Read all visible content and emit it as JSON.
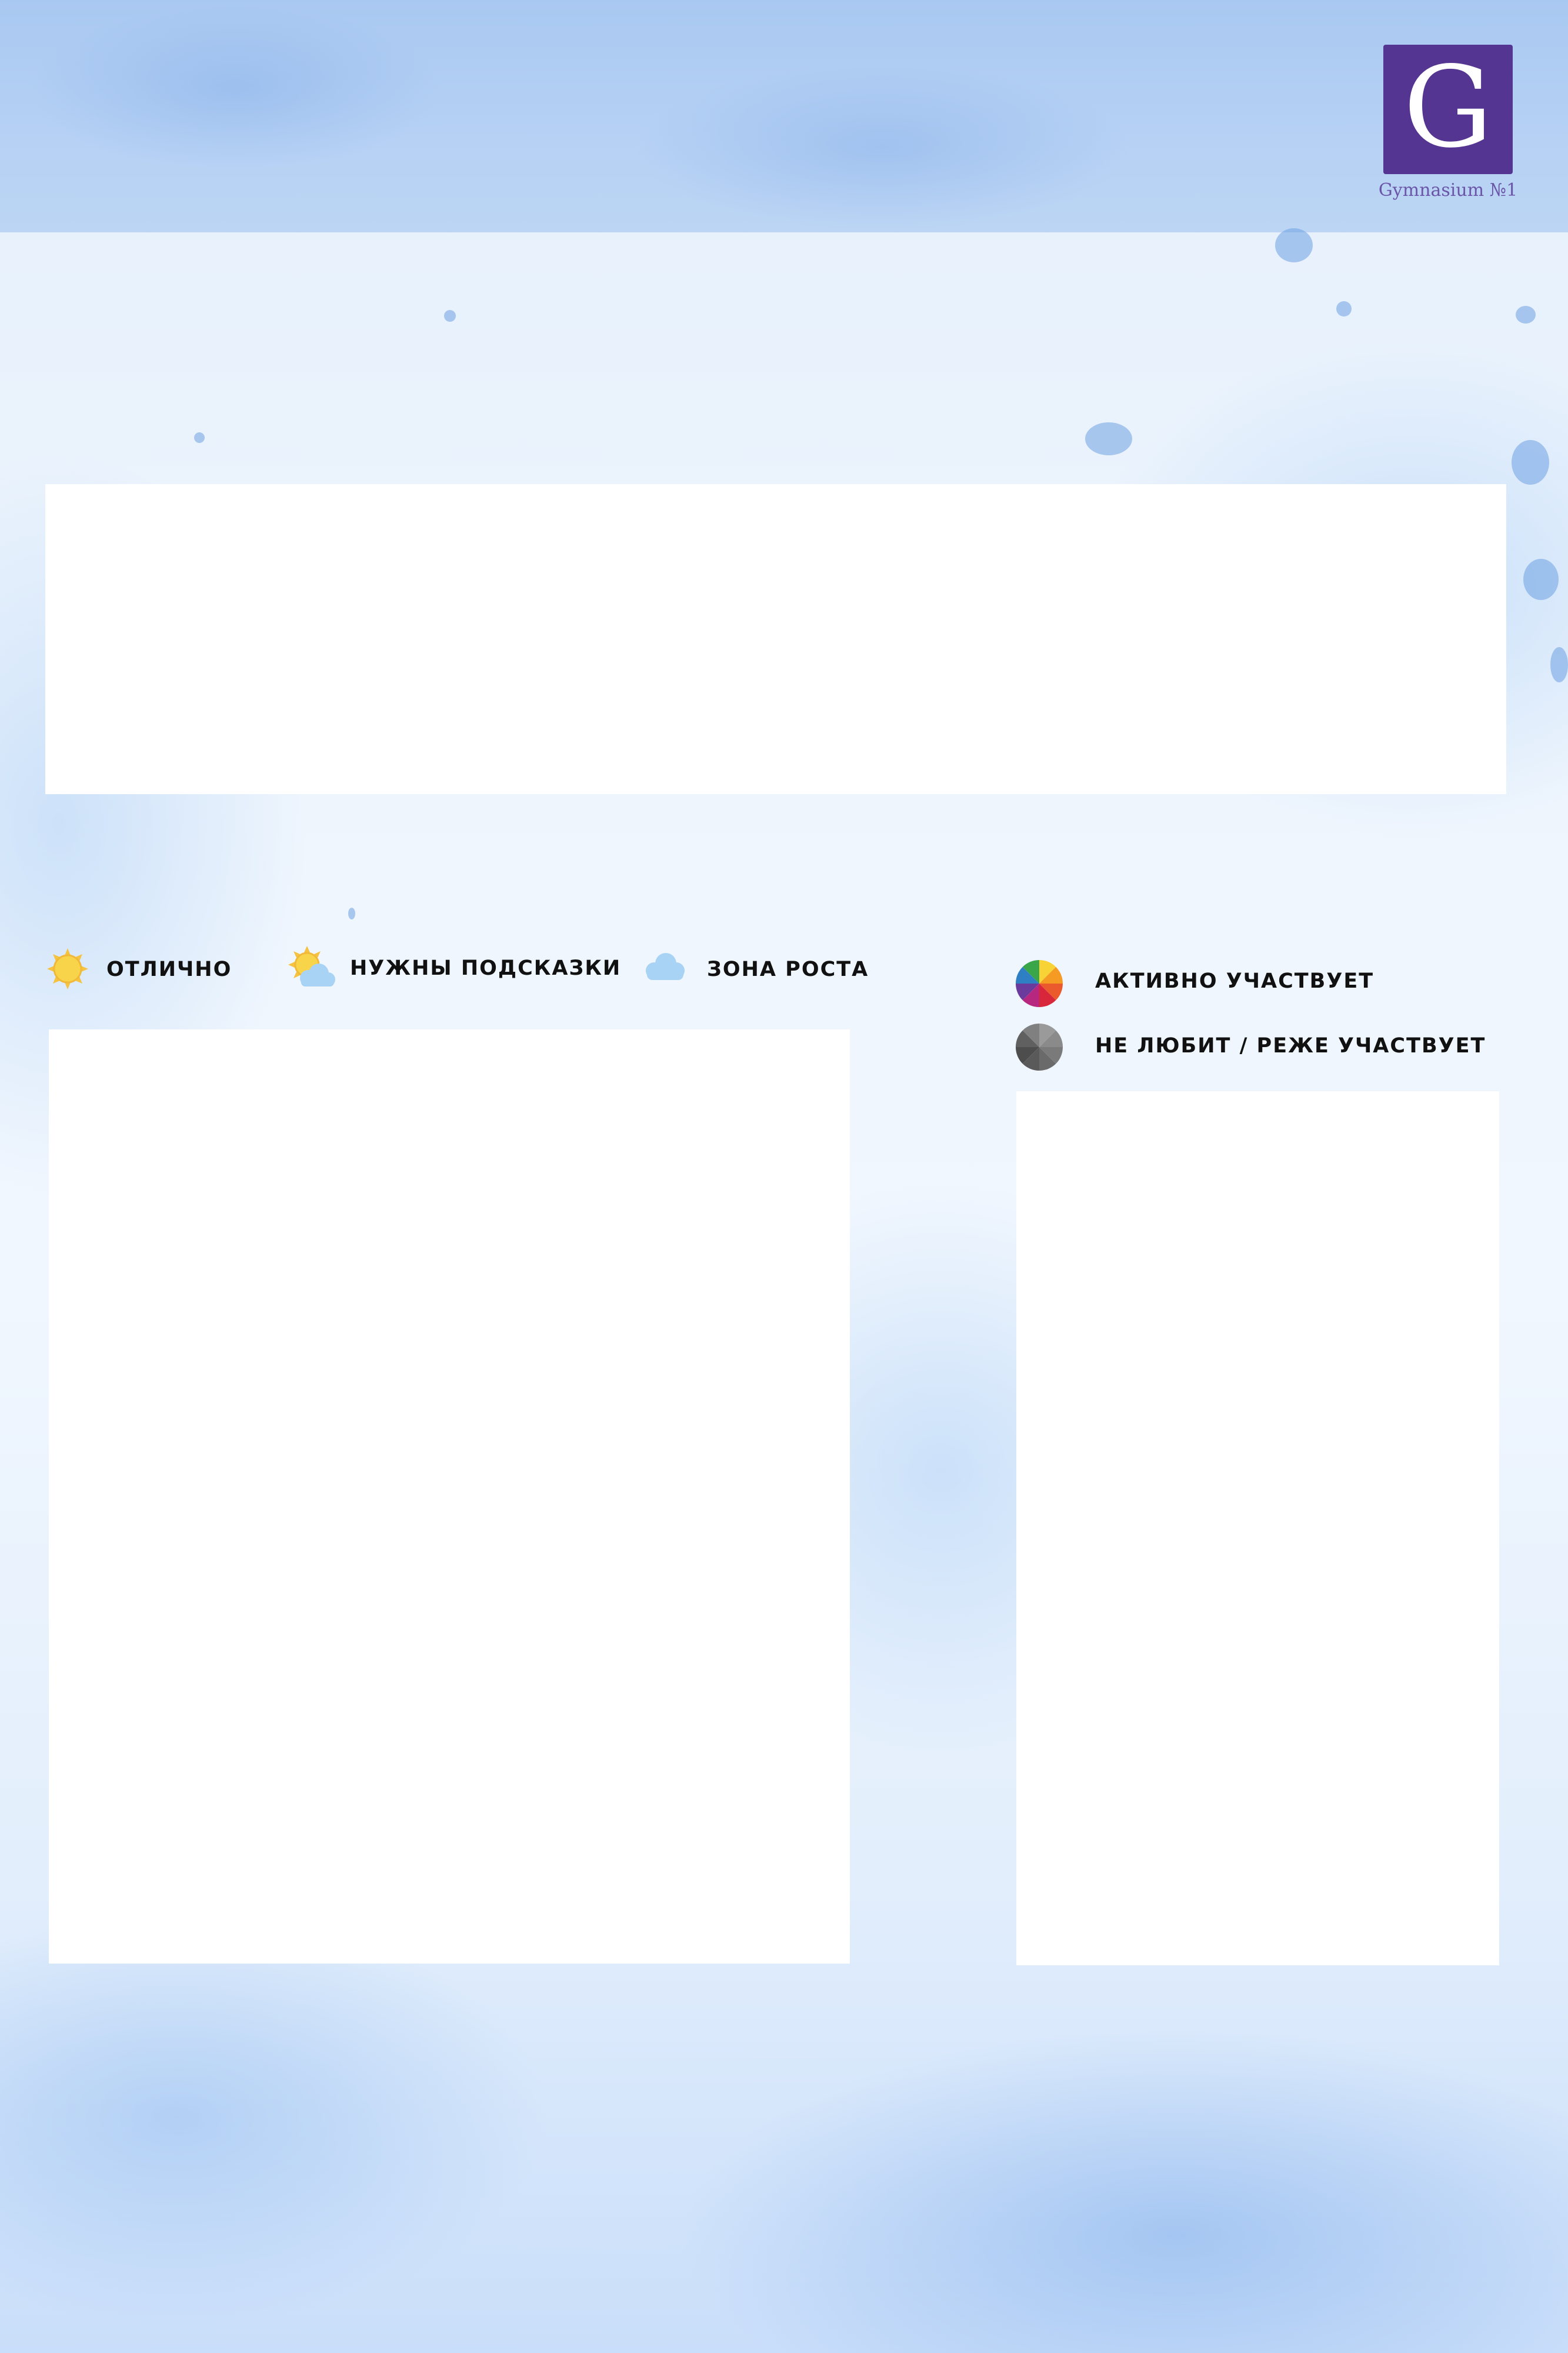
{
  "logo": {
    "letter": "G",
    "caption": "Gymnasium №1",
    "color": "#553592"
  },
  "legend_rating": {
    "items": [
      {
        "label": "ОТЛИЧНО",
        "icon": "sun-icon"
      },
      {
        "label": "НУЖНЫ ПОДСКАЗКИ",
        "icon": "sun-behind-cloud-icon"
      },
      {
        "label": "ЗОНА РОСТА",
        "icon": "cloud-icon"
      }
    ]
  },
  "legend_participation": {
    "items": [
      {
        "label": "АКТИВНО УЧАСТВУЕТ",
        "icon": "color-wheel-icon"
      },
      {
        "label": "НЕ ЛЮБИТ / РЕЖЕ УЧАСТВУЕТ",
        "icon": "grey-wheel-icon"
      }
    ]
  },
  "colors": {
    "background": "#eaf3fd",
    "band": "#b6d1f4",
    "sun": "#f7d44a",
    "cloud": "#a8d3f5"
  }
}
